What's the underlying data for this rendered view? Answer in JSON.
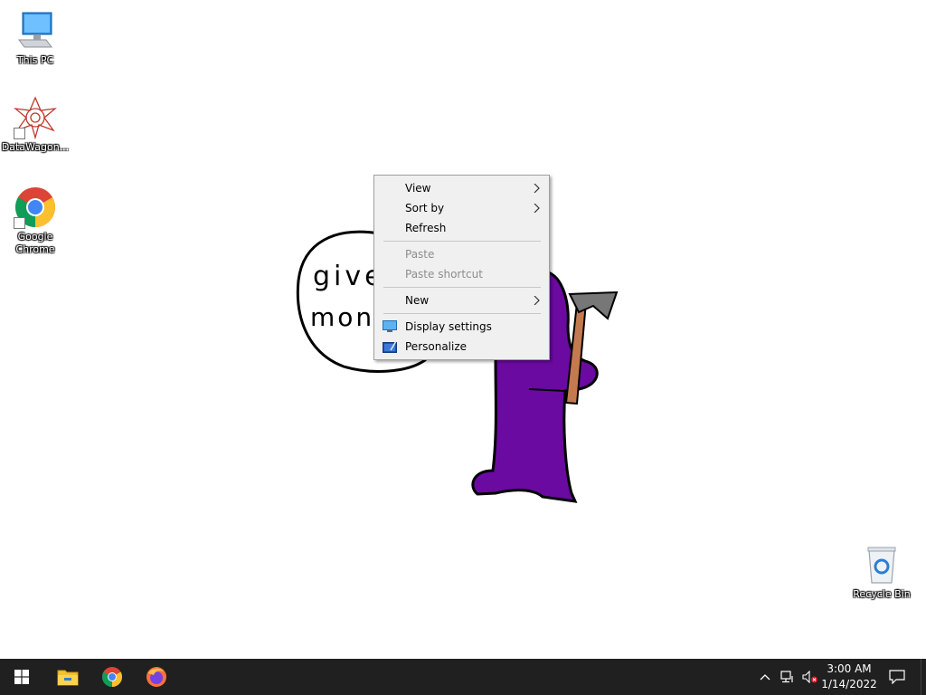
{
  "desktop_icons": [
    {
      "name": "This PC"
    },
    {
      "name": "DataWagon..."
    },
    {
      "name": "Google Chrome"
    },
    {
      "name": "Recycle Bin"
    }
  ],
  "wallpaper": {
    "speech_line1": "give",
    "speech_line2": "mon"
  },
  "context_menu": {
    "view": "View",
    "sort_by": "Sort by",
    "refresh": "Refresh",
    "paste": "Paste",
    "paste_shortcut": "Paste shortcut",
    "new": "New",
    "display_settings": "Display settings",
    "personalize": "Personalize"
  },
  "taskbar": {
    "pinned": [
      "File Explorer",
      "Google Chrome",
      "Firefox"
    ],
    "clock_time": "3:00 AM",
    "clock_date": "1/14/2022"
  },
  "colors": {
    "taskbar": "#202020",
    "menu_bg": "#f0f0f0",
    "creature": "#6a0aa0",
    "axe_handle": "#c47a4f"
  }
}
